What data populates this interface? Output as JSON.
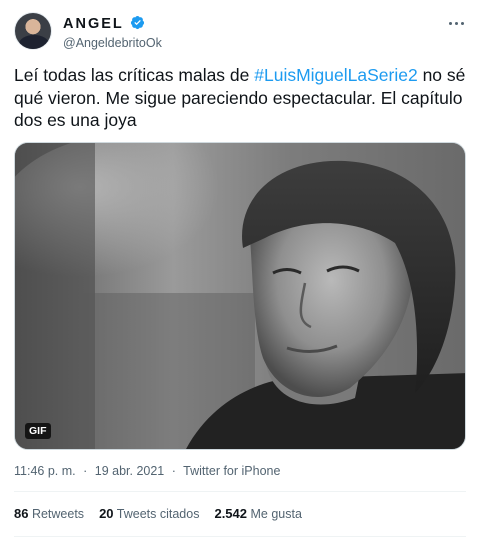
{
  "author": {
    "display_name": "ANGEL",
    "handle": "@AngeldebritoOk",
    "verified": true
  },
  "tweet": {
    "text_before": "Leí todas las críticas malas de ",
    "hashtag": "#LuisMiguelLaSerie2",
    "text_after": " no sé qué vieron. Me sigue pareciendo espectacular. El capítulo dos es una joya"
  },
  "media": {
    "badge": "GIF"
  },
  "meta": {
    "time": "11:46 p. m.",
    "separator": "·",
    "date": "19 abr. 2021",
    "source": "Twitter for iPhone"
  },
  "stats": {
    "retweets_count": "86",
    "retweets_label": "Retweets",
    "quotes_count": "20",
    "quotes_label": "Tweets citados",
    "likes_count": "2.542",
    "likes_label": "Me gusta"
  },
  "icons": {
    "more": "more-options-icon",
    "verified": "verified-badge-icon"
  },
  "colors": {
    "accent": "#1d9bf0",
    "secondary_text": "#536471",
    "primary_text": "#0f1419"
  }
}
